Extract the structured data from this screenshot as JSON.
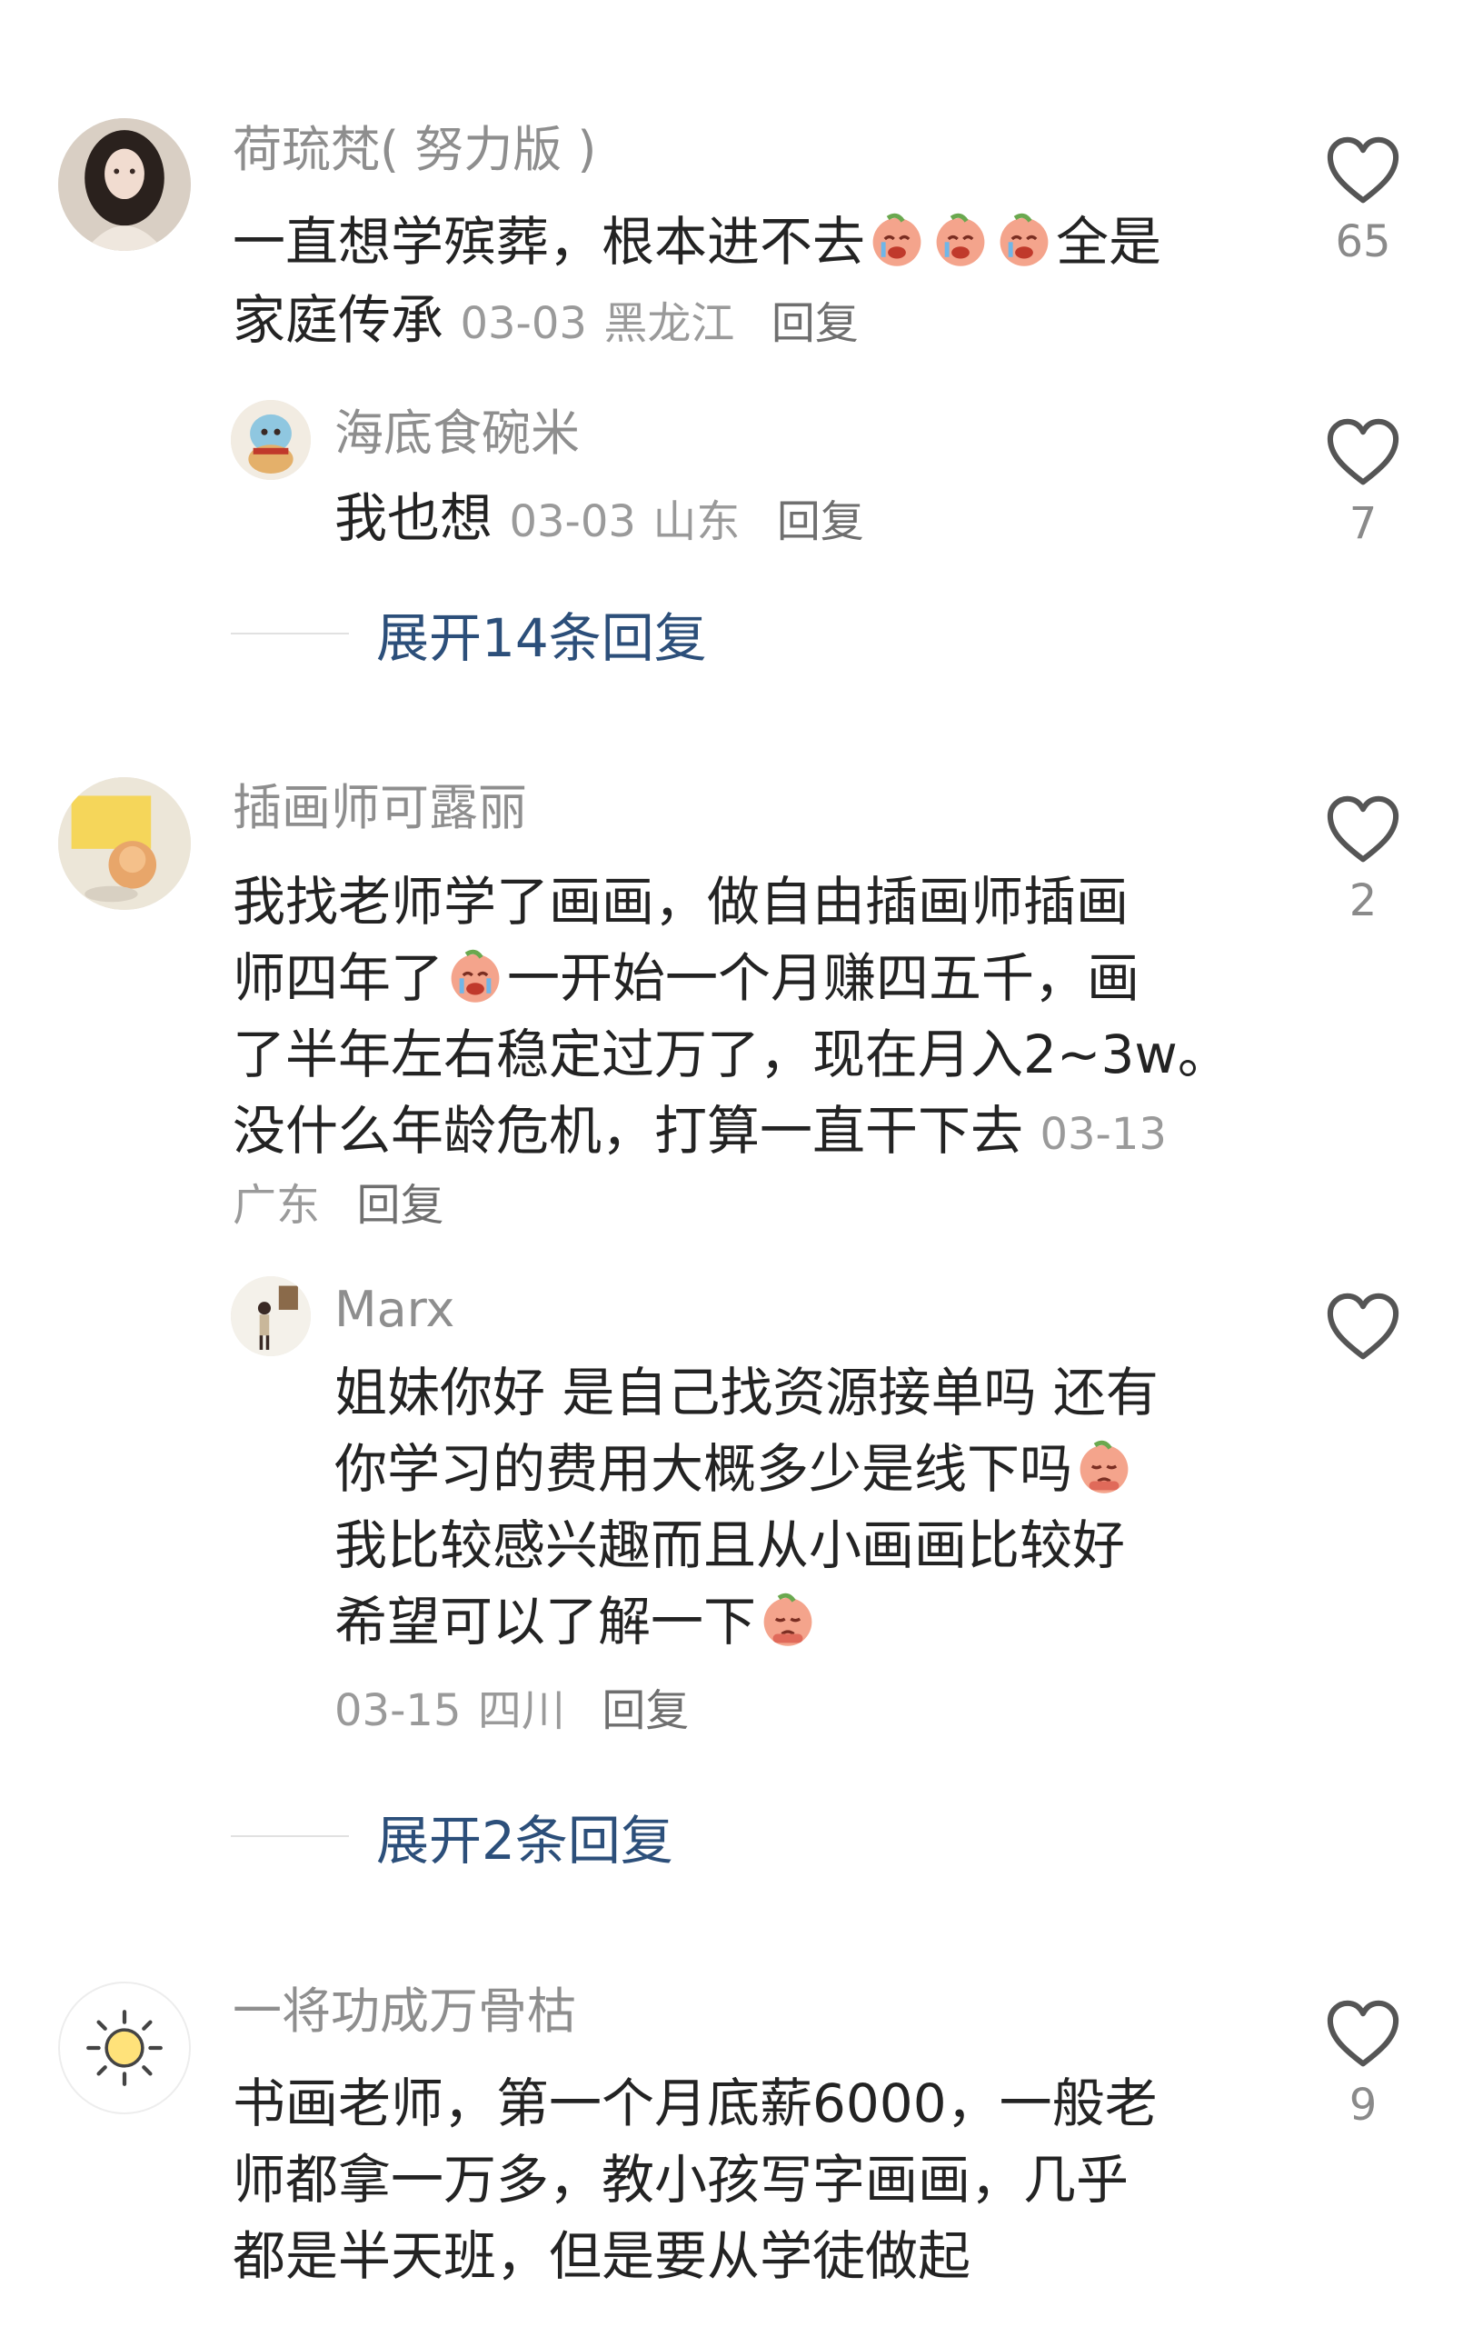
{
  "comments": [
    {
      "author": "荷琉梵( 努力版 )",
      "text_line1": "一直想学殡葬，根本进不去",
      "text_line1_tail": "全是",
      "text_line2": "家庭传承",
      "date": "03-03",
      "location": "黑龙江",
      "reply_label": "回复",
      "likes": "65",
      "emoji": "crying-face-emoji",
      "replies": [
        {
          "author": "海底食碗米",
          "text": "我也想",
          "date": "03-03",
          "location": "山东",
          "reply_label": "回复",
          "likes": "7"
        }
      ],
      "expand_label": "展开14条回复"
    },
    {
      "author": "插画师可露丽",
      "lines": [
        "我找老师学了画画，做自由插画师插画",
        "一开始一个月赚四五千，画",
        "了半年左右稳定过万了，现在月入2~3w。",
        "没什么年龄危机，打算一直干下去"
      ],
      "line2_head": "师四年了",
      "date": "03-13",
      "location": "广东",
      "reply_label": "回复",
      "likes": "2",
      "replies": [
        {
          "author": "Marx",
          "lines": [
            "姐妹你好 是自己找资源接单吗 还有",
            "你学习的费用大概多少是线下吗",
            "我比较感兴趣而且从小画画比较好",
            "希望可以了解一下"
          ],
          "date": "03-15",
          "location": "四川",
          "reply_label": "回复",
          "likes": ""
        }
      ],
      "expand_label": "展开2条回复"
    },
    {
      "author": "一将功成万骨枯",
      "lines": [
        "书画老师，第一个月底薪6000，一般老",
        "师都拿一万多，教小孩写字画画，几乎",
        "都是半天班，但是要从学徒做起"
      ],
      "likes": "9"
    }
  ],
  "colors": {
    "author": "#8e8e8e",
    "text": "#232323",
    "meta": "#9a9a9a",
    "expand": "#2c4f7a",
    "heart": "#555555"
  },
  "icons": {
    "like": "heart-outline-icon",
    "sun_avatar": "sun-icon"
  }
}
